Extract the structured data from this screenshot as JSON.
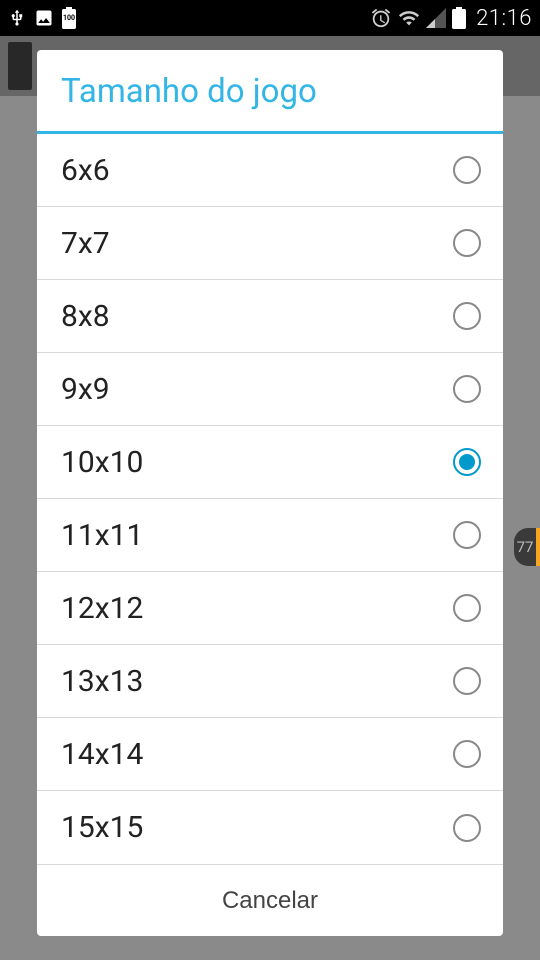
{
  "statusbar": {
    "time": "21:16",
    "battery_100": "100"
  },
  "side_indicator": "77",
  "dialog": {
    "title": "Tamanho do jogo",
    "cancel": "Cancelar",
    "selected_index": 4,
    "options": [
      {
        "label": "6x6"
      },
      {
        "label": "7x7"
      },
      {
        "label": "8x8"
      },
      {
        "label": "9x9"
      },
      {
        "label": "10x10"
      },
      {
        "label": "11x11"
      },
      {
        "label": "12x12"
      },
      {
        "label": "13x13"
      },
      {
        "label": "14x14"
      },
      {
        "label": "15x15"
      }
    ]
  }
}
